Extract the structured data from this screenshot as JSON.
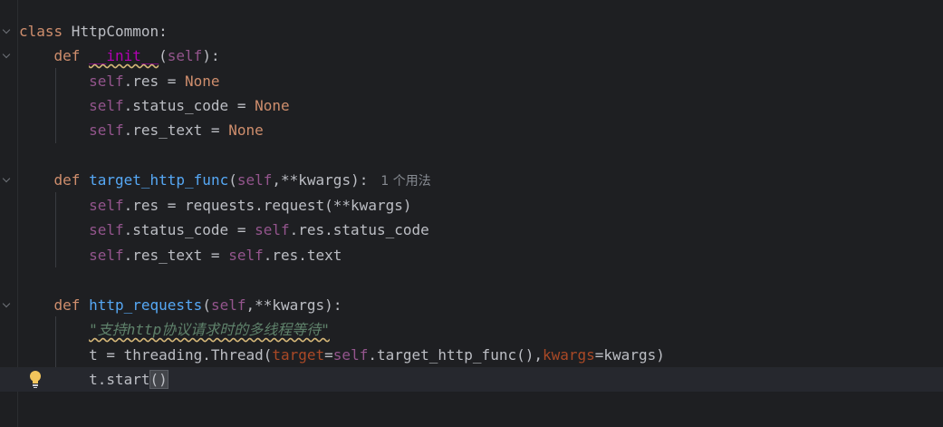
{
  "editor": {
    "language": "python",
    "lines": [
      {
        "text": "class HttpCommon:"
      },
      {
        "text": "    def __init__(self):"
      },
      {
        "text": "        self.res = None"
      },
      {
        "text": "        self.status_code = None"
      },
      {
        "text": "        self.res_text = None"
      },
      {
        "text": ""
      },
      {
        "text": "    def target_http_func(self,**kwargs):",
        "inlay_hint": "1 个用法"
      },
      {
        "text": "        self.res = requests.request(**kwargs)"
      },
      {
        "text": "        self.status_code = self.res.status_code"
      },
      {
        "text": "        self.res_text = self.res.text"
      },
      {
        "text": ""
      },
      {
        "text": "    def http_requests(self,**kwargs):"
      },
      {
        "text": "        \"支持http协议请求时的多线程等待\""
      },
      {
        "text": "        t = threading.Thread(target=self.target_http_func(),kwargs=kwargs)"
      },
      {
        "text": "        t.start()",
        "current": true
      }
    ],
    "tokens": {
      "class_kw": "class",
      "class_name": " HttpCommon:",
      "def_kw": "def",
      "init_name": "__init__",
      "self_kw": "self",
      "none_kw": "None",
      "func_target": "target_http_func",
      "func_http": "http_requests",
      "kw_target": "target",
      "kw_kwargs": "kwargs",
      "docstring": "\"支持http协议请求时的多线程等待\"",
      "inlay_hint": "1 个用法"
    }
  },
  "colors": {
    "background": "#1e1f22",
    "keyword": "#cf8e6d",
    "self": "#94558d",
    "function": "#56a8f5",
    "dunder": "#b200b2",
    "parameter": "#aa4926",
    "docstring": "#5f826b",
    "text": "#bcbec4",
    "current_line": "#26282e"
  },
  "icons": {
    "fold": "chevron-down-icon",
    "intention": "lightbulb-icon"
  }
}
